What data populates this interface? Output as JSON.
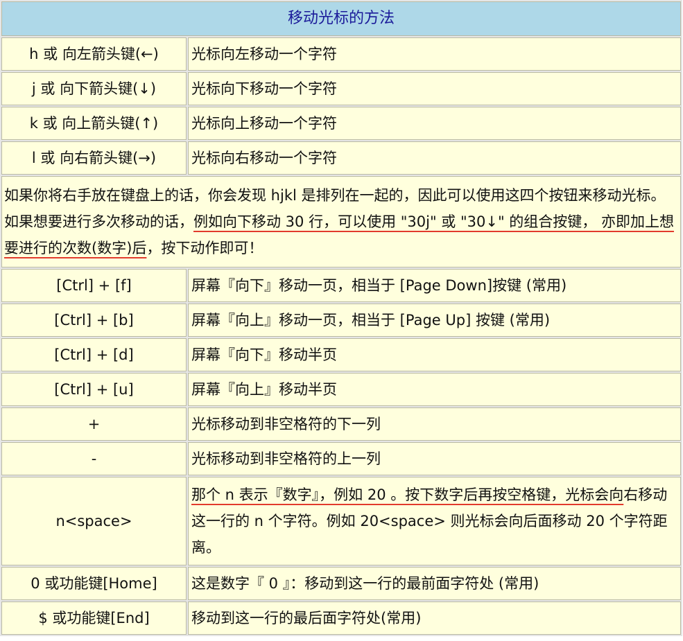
{
  "title": "移动光标的方法",
  "rows_a": [
    {
      "key": "h 或 向左箭头键(←)",
      "desc": "光标向左移动一个字符"
    },
    {
      "key": "j 或 向下箭头键(↓)",
      "desc": "光标向下移动一个字符"
    },
    {
      "key": "k 或 向上箭头键(↑)",
      "desc": "光标向上移动一个字符"
    },
    {
      "key": "l 或 向右箭头键(→)",
      "desc": "光标向右移动一个字符"
    }
  ],
  "note": {
    "part1": "如果你将右手放在键盘上的话，你会发现 hjkl 是排列在一起的，因此可以使用这四个按钮来移动光标。 如果想要进行多次移动的话，",
    "part2": "例如向下移动 30 行，可以使用 \"30j\" 或 \"30↓\" 的组合按键， 亦即加上想要进行的次数(数字)后",
    "part3": "，按下动作即可！"
  },
  "rows_b": [
    {
      "key": "[Ctrl] + [f]",
      "desc": "屏幕『向下』移动一页，相当于 [Page Down]按键 (常用)"
    },
    {
      "key": "[Ctrl] + [b]",
      "desc": "屏幕『向上』移动一页，相当于 [Page Up] 按键 (常用)"
    },
    {
      "key": "[Ctrl] + [d]",
      "desc": "屏幕『向下』移动半页"
    },
    {
      "key": "[Ctrl] + [u]",
      "desc": "屏幕『向上』移动半页"
    },
    {
      "key": "+",
      "desc": "光标移动到非空格符的下一列"
    },
    {
      "key": "-",
      "desc": "光标移动到非空格符的上一列"
    }
  ],
  "space_row": {
    "key": "n<space>",
    "desc_ul": "那个 n 表示『数字』，例如 20 。按下数字后再按空格键，光标会向",
    "desc_rest": "右移动这一行的 n 个字符。例如 20<space> 则光标会向后面移动 20 个字符距离。"
  },
  "rows_c": [
    {
      "key": "0 或功能键[Home]",
      "desc": "这是数字『 0 』：移动到这一行的最前面字符处 (常用)"
    },
    {
      "key": "$ 或功能键[End]",
      "desc": "移动到这一行的最后面字符处(常用)"
    }
  ]
}
